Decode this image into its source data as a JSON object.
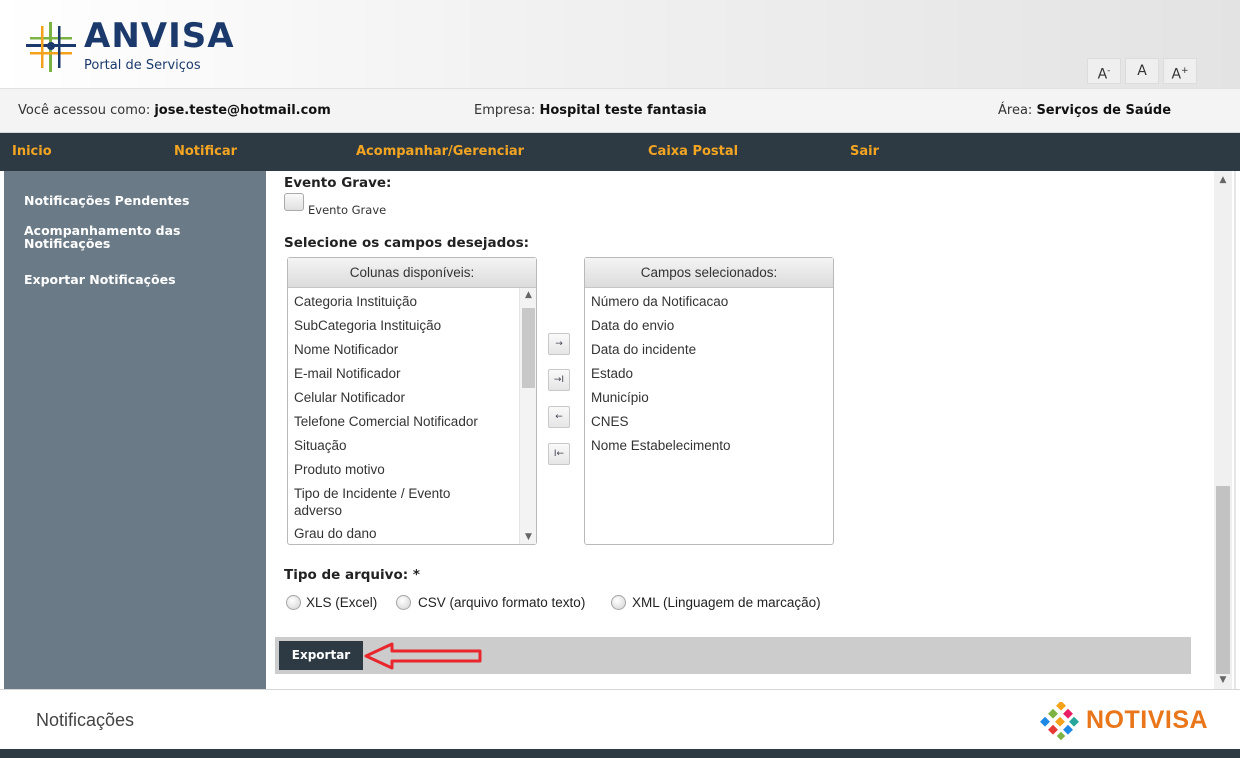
{
  "header": {
    "logo_title": "ANVISA",
    "logo_subtitle": "Portal de Serviços",
    "font_tools": {
      "decrease": "A",
      "decrease_sup": "-",
      "normal": "A",
      "increase": "A",
      "increase_sup": "+"
    }
  },
  "userbar": {
    "user_label": "Você acessou como:",
    "user_value": "jose.teste@hotmail.com",
    "company_label": "Empresa:",
    "company_value": "Hospital teste fantasia",
    "area_label": "Área:",
    "area_value": "Serviços de Saúde"
  },
  "nav": {
    "items": [
      "Inicio",
      "Notificar",
      "Acompanhar/Gerenciar",
      "Caixa Postal",
      "Sair"
    ]
  },
  "sidebar": {
    "items": [
      "Notificações Pendentes",
      "Acompanhamento das Notificações",
      "Exportar Notificações"
    ]
  },
  "form": {
    "evento_grave_heading": "Evento Grave:",
    "evento_grave_checkbox_label": "Evento Grave",
    "fields_heading": "Selecione os campos desejados:",
    "available_header": "Colunas disponíveis:",
    "available_items": [
      "Categoria Instituição",
      "SubCategoria Instituição",
      "Nome Notificador",
      "E-mail Notificador",
      "Celular Notificador",
      "Telefone Comercial Notificador",
      "Situação",
      "Produto motivo",
      "Tipo de Incidente / Evento adverso",
      "Grau do dano"
    ],
    "selected_header": "Campos selecionados:",
    "selected_items": [
      "Número da Notificacao",
      "Data do envio",
      "Data do incidente",
      "Estado",
      "Município",
      "CNES",
      "Nome Estabelecimento"
    ],
    "move_buttons": [
      "→",
      "→I",
      "←",
      "I←"
    ],
    "file_type_heading": "Tipo de arquivo: *",
    "file_types": [
      "XLS (Excel)",
      "CSV (arquivo formato texto)",
      "XML (Linguagem de marcação)"
    ],
    "export_label": "Exportar"
  },
  "footer": {
    "title": "Notificações",
    "brand": "NOTIVISA"
  },
  "colors": {
    "nav_bg": "#2d3a44",
    "nav_text": "#f3a521",
    "sidebar_bg": "#6a7a86",
    "brand_orange": "#e9761a",
    "annotation_arrow": "#e8262b"
  }
}
